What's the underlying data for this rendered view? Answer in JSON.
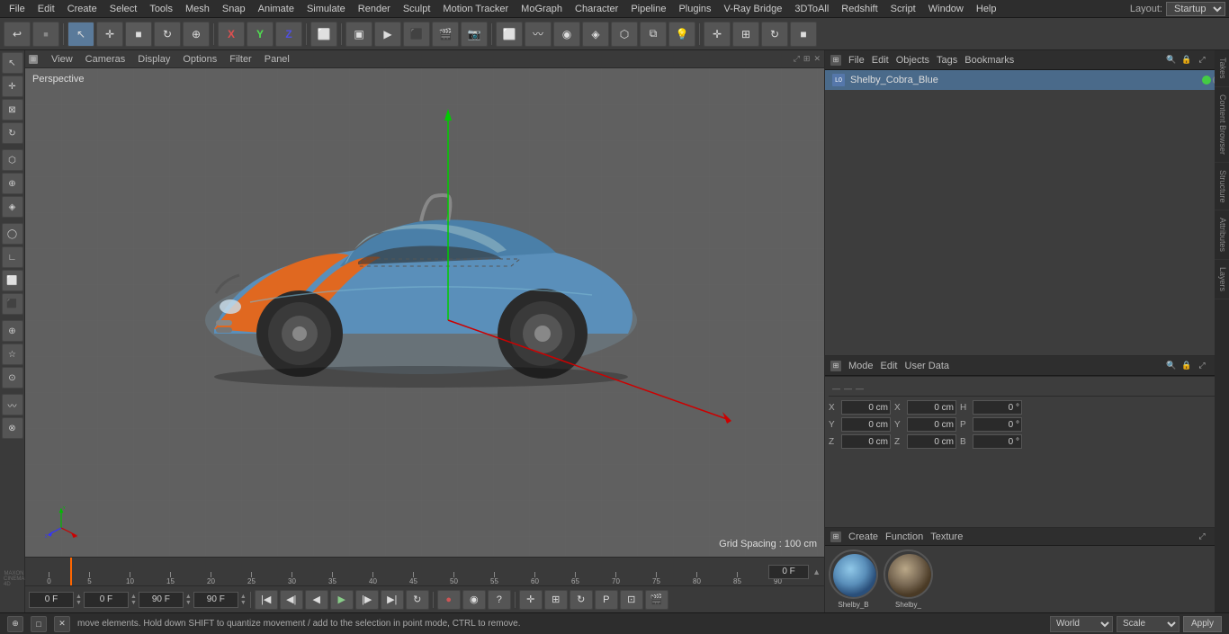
{
  "menubar": {
    "items": [
      {
        "label": "File",
        "id": "file"
      },
      {
        "label": "Edit",
        "id": "edit"
      },
      {
        "label": "Create",
        "id": "create"
      },
      {
        "label": "Select",
        "id": "select"
      },
      {
        "label": "Tools",
        "id": "tools"
      },
      {
        "label": "Mesh",
        "id": "mesh"
      },
      {
        "label": "Snap",
        "id": "snap"
      },
      {
        "label": "Animate",
        "id": "animate"
      },
      {
        "label": "Simulate",
        "id": "simulate"
      },
      {
        "label": "Render",
        "id": "render"
      },
      {
        "label": "Sculpt",
        "id": "sculpt"
      },
      {
        "label": "Motion Tracker",
        "id": "motion-tracker"
      },
      {
        "label": "MoGraph",
        "id": "mograph"
      },
      {
        "label": "Character",
        "id": "character"
      },
      {
        "label": "Pipeline",
        "id": "pipeline"
      },
      {
        "label": "Plugins",
        "id": "plugins"
      },
      {
        "label": "V-Ray Bridge",
        "id": "vray"
      },
      {
        "label": "3DToAll",
        "id": "3dtoall"
      },
      {
        "label": "Redshift",
        "id": "redshift"
      },
      {
        "label": "Script",
        "id": "script"
      },
      {
        "label": "Window",
        "id": "window"
      },
      {
        "label": "Help",
        "id": "help"
      }
    ],
    "layout_label": "Layout:",
    "layout_value": "Startup"
  },
  "viewport": {
    "mode_label": "Perspective",
    "menu_items": [
      "View",
      "Cameras",
      "Display",
      "Options",
      "Filter",
      "Panel"
    ],
    "grid_spacing": "Grid Spacing : 100 cm"
  },
  "timeline": {
    "markers": [
      0,
      5,
      10,
      15,
      20,
      25,
      30,
      35,
      40,
      45,
      50,
      55,
      60,
      65,
      70,
      75,
      80,
      85,
      90
    ],
    "current_frame": "0 F",
    "start_frame": "0 F",
    "end_frame": "90 F",
    "preview_start": "90 F",
    "preview_end": "90 F"
  },
  "objects_panel": {
    "header_menus": [
      "File",
      "Edit",
      "Objects",
      "Tags",
      "Bookmarks"
    ],
    "object_name": "Shelby_Cobra_Blue",
    "search_icon": "🔍"
  },
  "attributes_panel": {
    "header_menus": [
      "Mode",
      "Edit",
      "User Data"
    ]
  },
  "coordinates": {
    "x_pos": "0 cm",
    "y_pos": "0 cm",
    "z_pos": "0 cm",
    "x_rot": "0 cm",
    "y_rot": "0 cm",
    "z_rot": "0 cm",
    "h_rot": "0 °",
    "p_rot": "0 °",
    "b_rot": "0 °",
    "x_scale": "0 cm",
    "y_scale": "0 cm",
    "z_scale": "0 cm",
    "labels": {
      "x": "X",
      "y": "Y",
      "z": "Z",
      "h": "H",
      "p": "P",
      "b": "B"
    },
    "toolbar_dots": [
      "—",
      "—",
      "—"
    ]
  },
  "material_panel": {
    "menus": [
      "Create",
      "Function",
      "Texture"
    ],
    "materials": [
      {
        "name": "Shelby_B",
        "color": "#5a8fba"
      },
      {
        "name": "Shelby_",
        "color": "#7a6a55"
      }
    ]
  },
  "status_bar": {
    "text": "move elements. Hold down SHIFT to quantize movement / add to the selection in point mode, CTRL to remove.",
    "world_label": "World",
    "scale_label": "Scale",
    "apply_label": "Apply"
  },
  "right_tabs": [
    "Takes",
    "Content Browser",
    "Structure",
    "Attributes",
    "Layers"
  ],
  "coord_toolbar_icons": [
    "—",
    "—",
    "—",
    "—"
  ]
}
